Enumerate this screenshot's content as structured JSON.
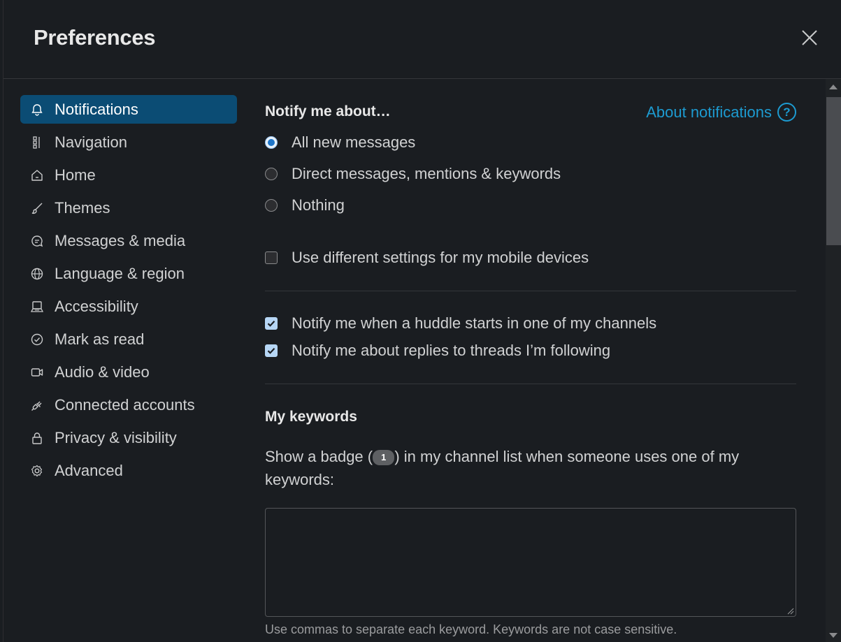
{
  "modal": {
    "title": "Preferences"
  },
  "sidebar": {
    "items": [
      {
        "label": "Notifications",
        "icon": "bell-icon",
        "active": true
      },
      {
        "label": "Navigation",
        "icon": "navigation-icon"
      },
      {
        "label": "Home",
        "icon": "home-icon"
      },
      {
        "label": "Themes",
        "icon": "brush-icon"
      },
      {
        "label": "Messages & media",
        "icon": "message-icon"
      },
      {
        "label": "Language & region",
        "icon": "globe-icon"
      },
      {
        "label": "Accessibility",
        "icon": "keyboard-icon"
      },
      {
        "label": "Mark as read",
        "icon": "check-circle-icon"
      },
      {
        "label": "Audio & video",
        "icon": "video-icon"
      },
      {
        "label": "Connected accounts",
        "icon": "plug-icon"
      },
      {
        "label": "Privacy & visibility",
        "icon": "lock-icon"
      },
      {
        "label": "Advanced",
        "icon": "gear-icon"
      }
    ]
  },
  "notifications": {
    "section_title": "Notify me about…",
    "about_link": "About notifications",
    "options": [
      {
        "label": "All new messages",
        "selected": true
      },
      {
        "label": "Direct messages, mentions & keywords",
        "selected": false
      },
      {
        "label": "Nothing",
        "selected": false
      }
    ],
    "mobile_checkbox": {
      "label": "Use different settings for my mobile devices",
      "checked": false
    },
    "huddle_checkbox": {
      "label": "Notify me when a huddle starts in one of my channels",
      "checked": true
    },
    "threads_checkbox": {
      "label": "Notify me about replies to threads I’m following",
      "checked": true
    }
  },
  "keywords": {
    "title": "My keywords",
    "desc_before": "Show a badge (",
    "badge": "1",
    "desc_after": ") in my channel list when someone uses one of my keywords:",
    "value": "",
    "hint": "Use commas to separate each keyword. Keywords are not case sensitive."
  },
  "colors": {
    "accent": "#1d9bd1",
    "active_nav": "#0b4c74",
    "background": "#1a1d21"
  }
}
